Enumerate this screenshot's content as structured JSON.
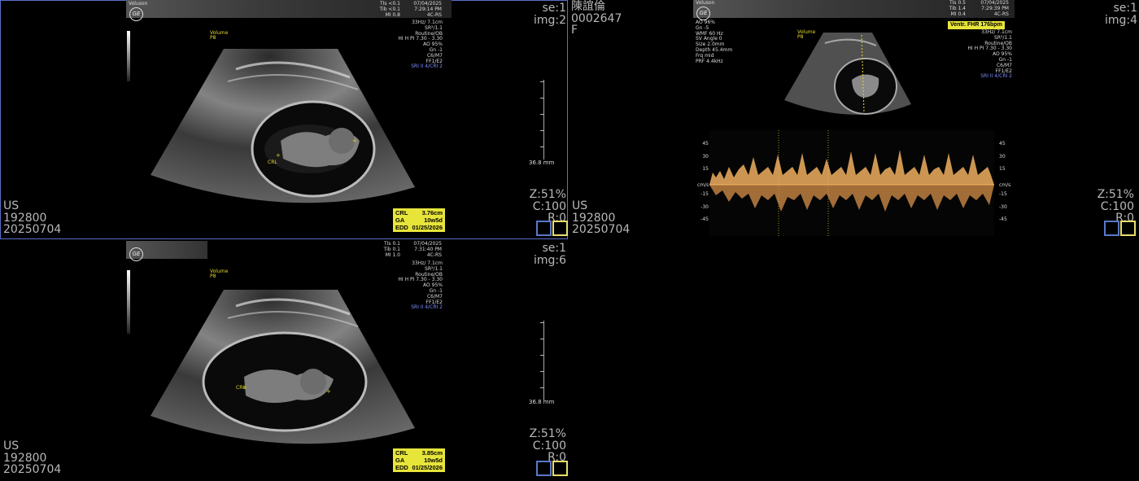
{
  "patient": {
    "name": "陳誼倫",
    "id": "0002647",
    "sex": "F"
  },
  "viewports": {
    "v1": {
      "series": "se:1",
      "image": "img:2",
      "readouts": {
        "tis": "TIs <0.1",
        "tib": "Tib <0.1",
        "mi": "MI  0.8",
        "date": "07/04/2025",
        "time": "7:29:14 PM",
        "probe": "4C-RS"
      },
      "params": [
        "33Hz/ 7.1cm",
        "SR²/1.1",
        "Routine/OB",
        "HI H PI 7.30 - 3.30",
        "AO 95%",
        "Gn  -1",
        "C6/M7",
        "FF1/E2",
        "SRI II 4/CRI 2"
      ],
      "volume": "Volume",
      "p": "P8",
      "modality": "US",
      "accession": "192800",
      "study_date": "20250704",
      "zoom": "Z:51%",
      "contrast": "C:100",
      "rotation": "R:0",
      "depth": "36.8 mm",
      "caliper_label": "CRL",
      "measurements": [
        {
          "label": "CRL",
          "value": "3.76cm"
        },
        {
          "label": "GA",
          "value": "10w5d"
        },
        {
          "label": "EDD",
          "value": "01/25/2026"
        }
      ]
    },
    "v2": {
      "series": "se:1",
      "image": "img:6",
      "readouts": {
        "tis": "TIs  0.1",
        "tib": "Tib  0.1",
        "mi": "MI  1.0",
        "date": "07/04/2025",
        "time": "7:31:40 PM",
        "probe": "4C-RS"
      },
      "params": [
        "33Hz/ 7.1cm",
        "SR²/1.1",
        "Routine/OB",
        "HI H PI 7.30 - 3.30",
        "AO 95%",
        "Gn  -1",
        "C6/M7",
        "FF1/E2",
        "SRI II 4/CRI 2"
      ],
      "volume": "Volume",
      "p": "P8",
      "modality": "US",
      "accession": "192800",
      "study_date": "20250704",
      "zoom": "Z:51%",
      "contrast": "C:100",
      "rotation": "R:0",
      "depth": "36.8 mm",
      "caliper_label": "CRL",
      "measurements": [
        {
          "label": "CRL",
          "value": "3.85cm"
        },
        {
          "label": "GA",
          "value": "10w5d"
        },
        {
          "label": "EDD",
          "value": "01/25/2026"
        }
      ]
    },
    "v3": {
      "series": "se:1",
      "image": "img:4",
      "readouts": {
        "tis": "TIs  0.5",
        "tib": "Tib  1.4",
        "mi": "MI  0.4",
        "date": "07/04/2025",
        "time": "7:29:39 PM",
        "probe": "4C-RS"
      },
      "left_params": [
        "AO 96%",
        "Gn  -5",
        "WMF 60 Hz",
        "SV Angle  0",
        "Size  2.0mm",
        "Depth 45.4mm",
        "Frq mid",
        "PRF  4.4kHz"
      ],
      "params": [
        "33Hz/ 7.1cm",
        "SR²/1.1",
        "Routine/OB",
        "HI H PI 7.30 - 3.30",
        "AO 95%",
        "Gn  -1",
        "C6/M7",
        "FF1/E2",
        "SRI II 4/CRI 2"
      ],
      "fhr": "Ventr. FHR 176bpm",
      "volume": "Volume",
      "p": "P8",
      "modality": "US",
      "accession": "192800",
      "study_date": "20250704",
      "zoom": "Z:51%",
      "contrast": "C:100",
      "rotation": "R:0",
      "doppler": {
        "unit": "cm/s",
        "ticks": [
          "45",
          "30",
          "15",
          "-15",
          "-30",
          "-45"
        ]
      }
    }
  },
  "colors": {
    "measurement_bg": "#e7e53a",
    "active_border": "#5a6fc9",
    "doppler": "#f0b060"
  }
}
